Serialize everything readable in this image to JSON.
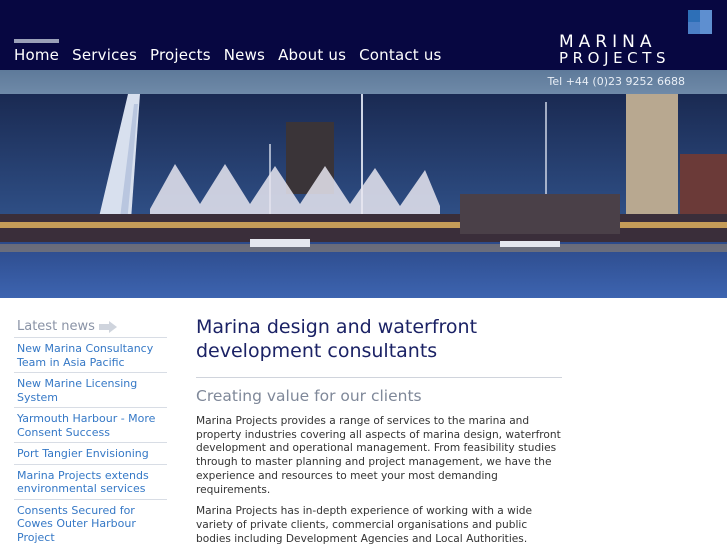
{
  "header": {
    "nav": [
      "Home",
      "Services",
      "Projects",
      "News",
      "About us",
      "Contact us"
    ],
    "active_nav": "Home",
    "logo_line1": "MARINA",
    "logo_line2": "PROJECTS",
    "phone": "Tel +44 (0)23 9252 6688"
  },
  "sidebar": {
    "title": "Latest news",
    "items": [
      "New Marina Consultancy Team in Asia Pacific",
      "New Marine Licensing System",
      "Yarmouth Harbour - More Consent Success",
      "Port Tangier Envisioning",
      "Marina Projects extends environmental services",
      "Consents Secured for Cowes Outer Harbour Project"
    ]
  },
  "main": {
    "headline": "Marina design and waterfront development consultants",
    "subhead": "Creating value for our clients",
    "paragraphs": [
      "Marina Projects provides a range of services to the marina and property industries covering all aspects of marina design, waterfront development and operational management. From feasibility studies through to master planning and project management, we have the experience and resources to meet your most demanding requirements.",
      "Marina Projects has in-depth experience of working with a wide variety of private clients, commercial organisations and public bodies including Development Agencies and Local Authorities."
    ]
  },
  "colors": {
    "header_bg": "#070741",
    "link": "#3578c6",
    "headline": "#1b2265",
    "subhead": "#7f8899"
  }
}
